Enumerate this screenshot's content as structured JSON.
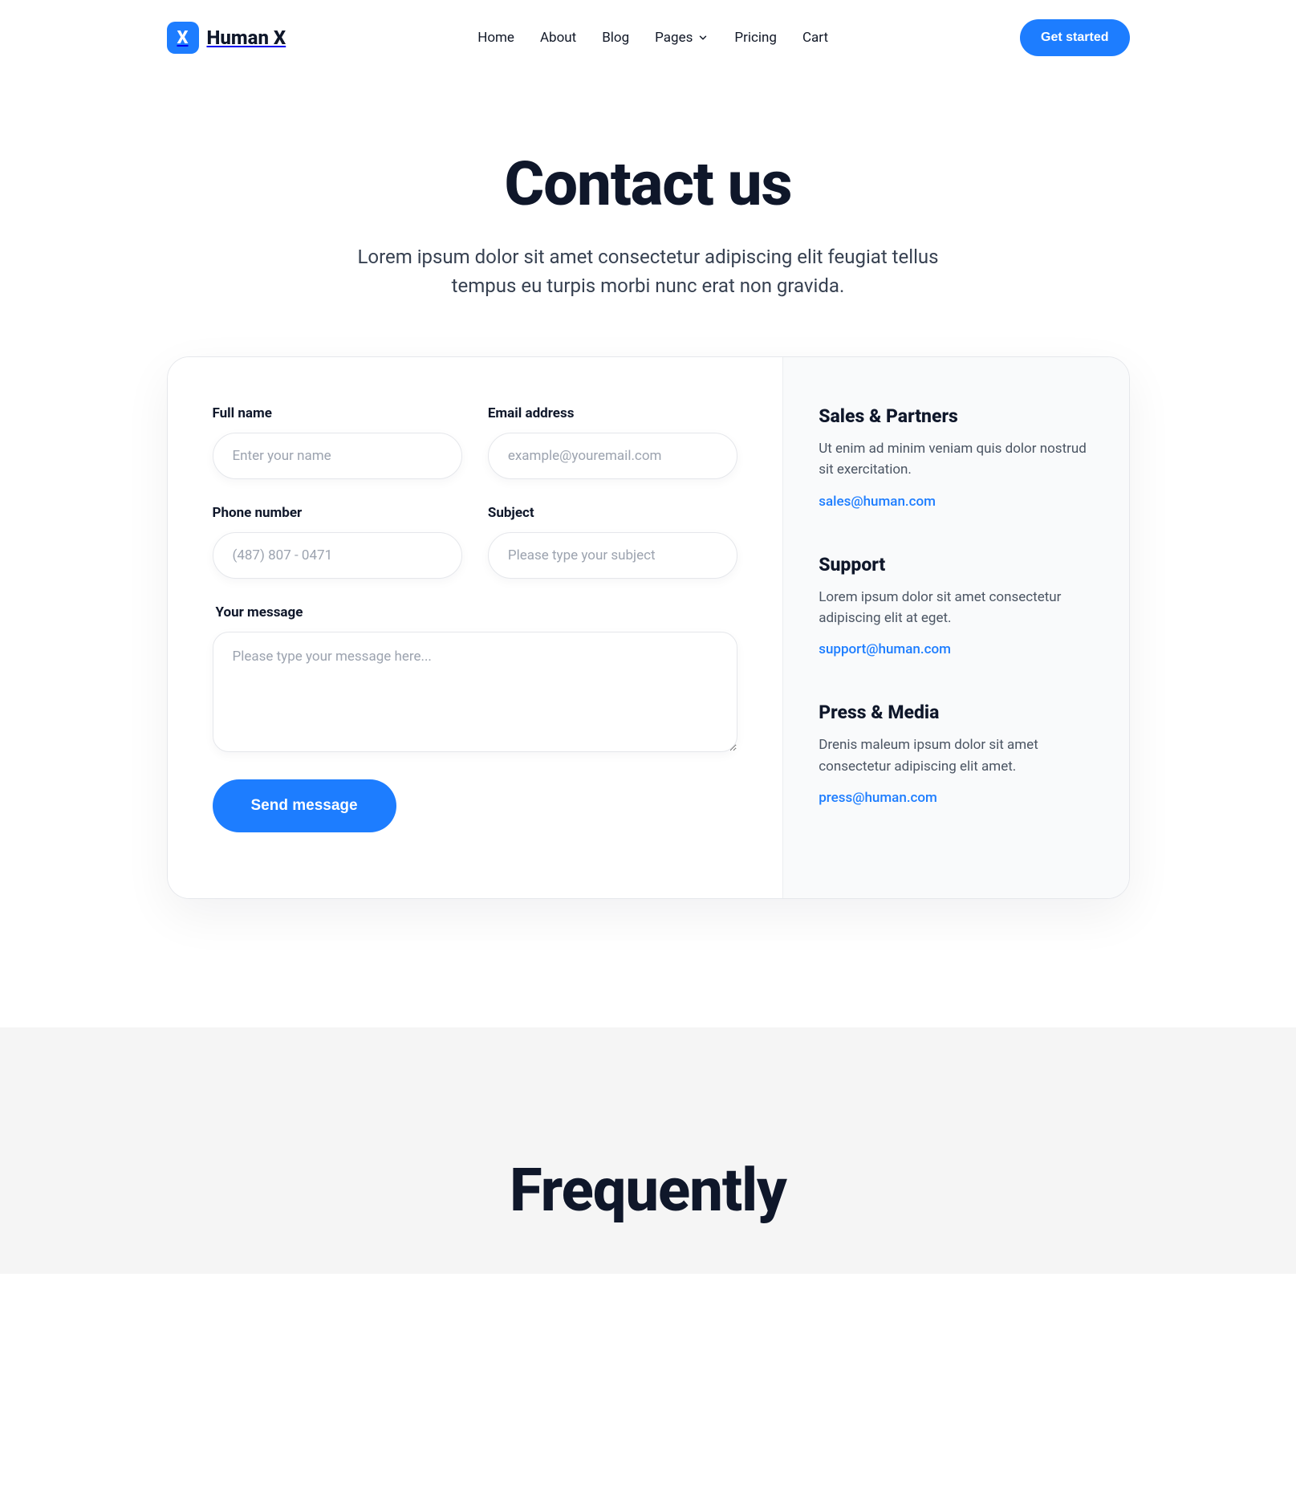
{
  "brand": {
    "logo_letter": "X",
    "name": "Human X"
  },
  "nav": {
    "items": [
      {
        "label": "Home"
      },
      {
        "label": "About"
      },
      {
        "label": "Blog"
      },
      {
        "label": "Pages"
      },
      {
        "label": "Pricing"
      },
      {
        "label": "Cart"
      }
    ]
  },
  "cta": {
    "label": "Get started"
  },
  "hero": {
    "title": "Contact us",
    "subtitle": "Lorem ipsum dolor sit amet consectetur adipiscing elit feugiat tellus tempus eu turpis morbi nunc erat non gravida."
  },
  "form": {
    "full_name": {
      "label": "Full name",
      "placeholder": "Enter your name"
    },
    "email": {
      "label": "Email address",
      "placeholder": "example@youremail.com"
    },
    "phone": {
      "label": "Phone number",
      "placeholder": "(487) 807 - 0471"
    },
    "subject": {
      "label": "Subject",
      "placeholder": "Please type your subject"
    },
    "message": {
      "label": "Your message",
      "placeholder": "Please type your message here..."
    },
    "submit": "Send message"
  },
  "info": [
    {
      "title": "Sales & Partners",
      "text": "Ut enim ad minim veniam quis dolor nostrud sit exercitation.",
      "email": "sales@human.com"
    },
    {
      "title": "Support",
      "text": "Lorem ipsum dolor sit amet consectetur adipiscing elit at eget.",
      "email": "support@human.com"
    },
    {
      "title": "Press & Media",
      "text": "Drenis maleum ipsum dolor sit amet consectetur adipiscing elit amet.",
      "email": "press@human.com"
    }
  ],
  "faq": {
    "title": "Frequently"
  }
}
